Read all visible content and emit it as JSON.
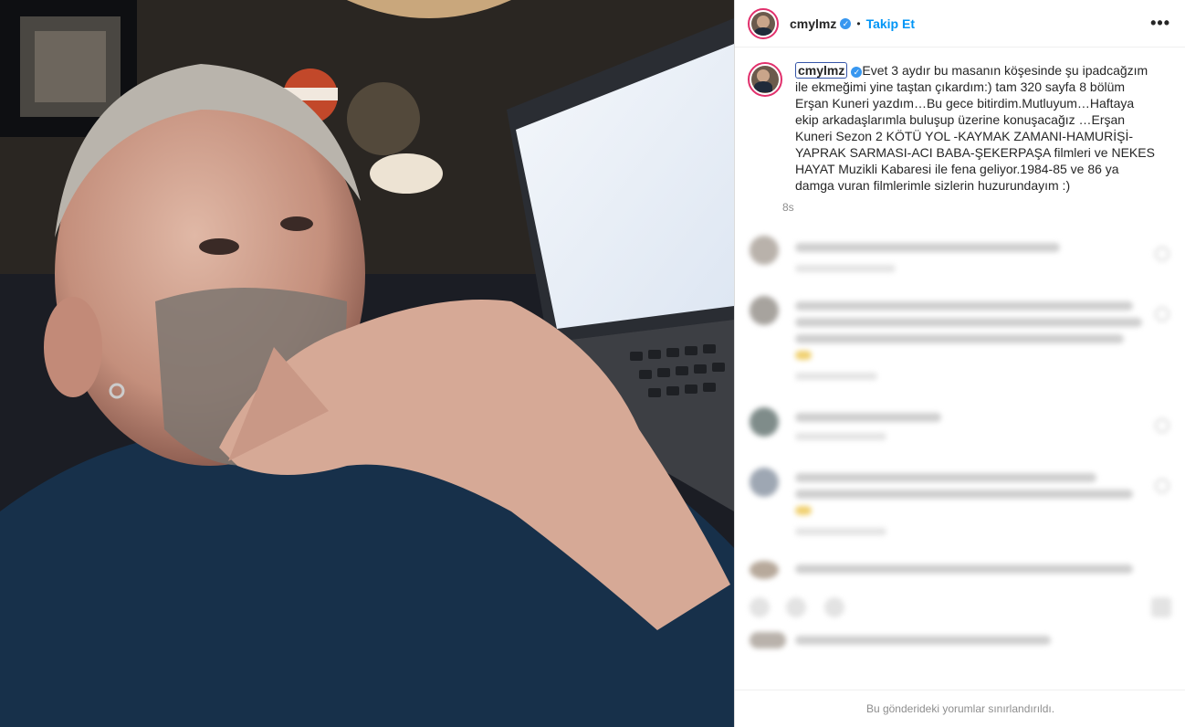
{
  "post": {
    "username": "cmylmz",
    "verified_icon": "verified-badge-icon",
    "separator": "•",
    "follow_label": "Takip Et",
    "more_icon": "•••",
    "caption": "Evet 3 aydır bu masanın köşesinde şu ipadcağzım ile ekmeğimi yine taştan çıkardım:) tam 320 sayfa 8 bölüm Erşan Kuneri yazdım…Bu gece bitirdim.Mutluyum…Haftaya ekip arkadaşlarımla buluşup üzerine konuşacağız …Erşan Kuneri Sezon 2 KÖTÜ YOL -KAYMAK ZAMANI-HAMURİŞİ-YAPRAK SARMASI-ACI BABA-ŞEKERPAŞA filmleri ve NEKES HAYAT Muzikli Kabaresi ile fena geliyor.1984-85 ve 86 ya damga vuran filmlerimle sizlerin huzurundayım :)",
    "time": "8s"
  },
  "footer": {
    "comments_limited": "Bu gönderideki yorumlar sınırlandırıldı."
  },
  "colors": {
    "accent": "#0095f6",
    "verified": "#3897f0",
    "story_ring": "#e1306c"
  }
}
